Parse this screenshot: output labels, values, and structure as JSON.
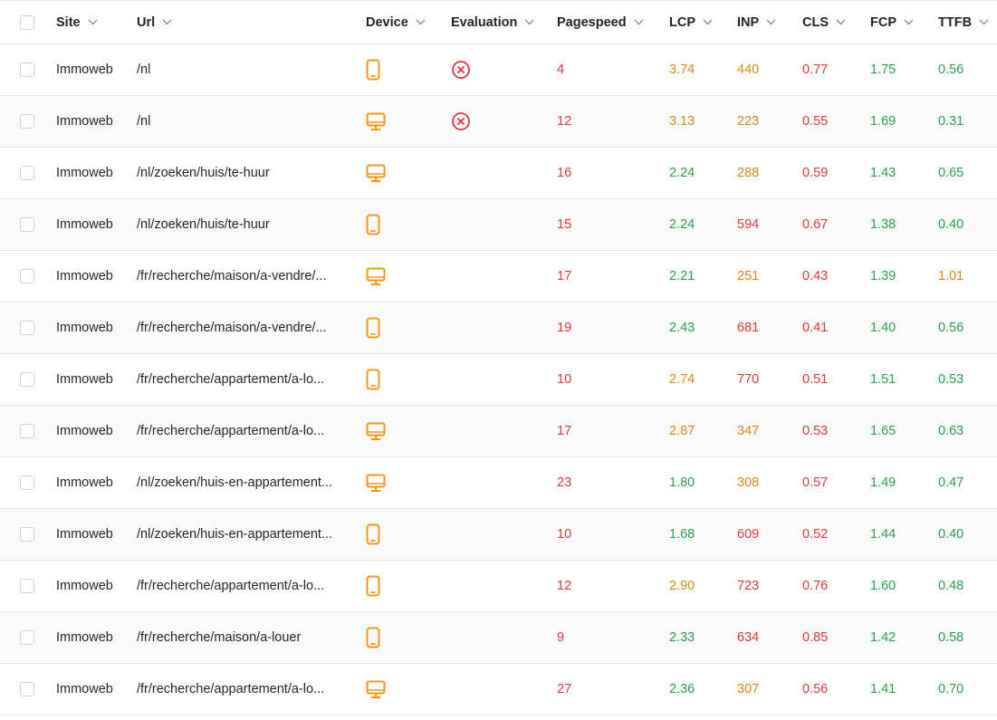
{
  "colors": {
    "good": "#2e9e4f",
    "warn": "#d9891a",
    "bad": "#e0383e",
    "device": "#f09a1a"
  },
  "header": {
    "site": "Site",
    "url": "Url",
    "device": "Device",
    "evaluation": "Evaluation",
    "pagespeed": "Pagespeed",
    "lcp": "LCP",
    "inp": "INP",
    "cls": "CLS",
    "fcp": "FCP",
    "ttfb": "TTFB"
  },
  "rows": [
    {
      "site": "Immoweb",
      "url": "/nl",
      "device": "mobile",
      "evaluation": "failed",
      "pagespeed": {
        "v": "4",
        "s": "bad"
      },
      "lcp": {
        "v": "3.74",
        "s": "warn"
      },
      "inp": {
        "v": "440",
        "s": "warn"
      },
      "cls": {
        "v": "0.77",
        "s": "bad"
      },
      "fcp": {
        "v": "1.75",
        "s": "good"
      },
      "ttfb": {
        "v": "0.56",
        "s": "good"
      }
    },
    {
      "site": "Immoweb",
      "url": "/nl",
      "device": "desktop",
      "evaluation": "failed",
      "pagespeed": {
        "v": "12",
        "s": "bad"
      },
      "lcp": {
        "v": "3.13",
        "s": "warn"
      },
      "inp": {
        "v": "223",
        "s": "warn"
      },
      "cls": {
        "v": "0.55",
        "s": "bad"
      },
      "fcp": {
        "v": "1.69",
        "s": "good"
      },
      "ttfb": {
        "v": "0.31",
        "s": "good"
      }
    },
    {
      "site": "Immoweb",
      "url": "/nl/zoeken/huis/te-huur",
      "device": "desktop",
      "evaluation": "",
      "pagespeed": {
        "v": "16",
        "s": "bad"
      },
      "lcp": {
        "v": "2.24",
        "s": "good"
      },
      "inp": {
        "v": "288",
        "s": "warn"
      },
      "cls": {
        "v": "0.59",
        "s": "bad"
      },
      "fcp": {
        "v": "1.43",
        "s": "good"
      },
      "ttfb": {
        "v": "0.65",
        "s": "good"
      }
    },
    {
      "site": "Immoweb",
      "url": "/nl/zoeken/huis/te-huur",
      "device": "mobile",
      "evaluation": "",
      "pagespeed": {
        "v": "15",
        "s": "bad"
      },
      "lcp": {
        "v": "2.24",
        "s": "good"
      },
      "inp": {
        "v": "594",
        "s": "bad"
      },
      "cls": {
        "v": "0.67",
        "s": "bad"
      },
      "fcp": {
        "v": "1.38",
        "s": "good"
      },
      "ttfb": {
        "v": "0.40",
        "s": "good"
      }
    },
    {
      "site": "Immoweb",
      "url": "/fr/recherche/maison/a-vendre/...",
      "device": "desktop",
      "evaluation": "",
      "pagespeed": {
        "v": "17",
        "s": "bad"
      },
      "lcp": {
        "v": "2.21",
        "s": "good"
      },
      "inp": {
        "v": "251",
        "s": "warn"
      },
      "cls": {
        "v": "0.43",
        "s": "bad"
      },
      "fcp": {
        "v": "1.39",
        "s": "good"
      },
      "ttfb": {
        "v": "1.01",
        "s": "warn"
      }
    },
    {
      "site": "Immoweb",
      "url": "/fr/recherche/maison/a-vendre/...",
      "device": "mobile",
      "evaluation": "",
      "pagespeed": {
        "v": "19",
        "s": "bad"
      },
      "lcp": {
        "v": "2.43",
        "s": "good"
      },
      "inp": {
        "v": "681",
        "s": "bad"
      },
      "cls": {
        "v": "0.41",
        "s": "bad"
      },
      "fcp": {
        "v": "1.40",
        "s": "good"
      },
      "ttfb": {
        "v": "0.56",
        "s": "good"
      }
    },
    {
      "site": "Immoweb",
      "url": "/fr/recherche/appartement/a-lo...",
      "device": "mobile",
      "evaluation": "",
      "pagespeed": {
        "v": "10",
        "s": "bad"
      },
      "lcp": {
        "v": "2.74",
        "s": "warn"
      },
      "inp": {
        "v": "770",
        "s": "bad"
      },
      "cls": {
        "v": "0.51",
        "s": "bad"
      },
      "fcp": {
        "v": "1.51",
        "s": "good"
      },
      "ttfb": {
        "v": "0.53",
        "s": "good"
      }
    },
    {
      "site": "Immoweb",
      "url": "/fr/recherche/appartement/a-lo...",
      "device": "desktop",
      "evaluation": "",
      "pagespeed": {
        "v": "17",
        "s": "bad"
      },
      "lcp": {
        "v": "2.87",
        "s": "warn"
      },
      "inp": {
        "v": "347",
        "s": "warn"
      },
      "cls": {
        "v": "0.53",
        "s": "bad"
      },
      "fcp": {
        "v": "1.65",
        "s": "good"
      },
      "ttfb": {
        "v": "0.63",
        "s": "good"
      }
    },
    {
      "site": "Immoweb",
      "url": "/nl/zoeken/huis-en-appartement...",
      "device": "desktop",
      "evaluation": "",
      "pagespeed": {
        "v": "23",
        "s": "bad"
      },
      "lcp": {
        "v": "1.80",
        "s": "good"
      },
      "inp": {
        "v": "308",
        "s": "warn"
      },
      "cls": {
        "v": "0.57",
        "s": "bad"
      },
      "fcp": {
        "v": "1.49",
        "s": "good"
      },
      "ttfb": {
        "v": "0.47",
        "s": "good"
      }
    },
    {
      "site": "Immoweb",
      "url": "/nl/zoeken/huis-en-appartement...",
      "device": "mobile",
      "evaluation": "",
      "pagespeed": {
        "v": "10",
        "s": "bad"
      },
      "lcp": {
        "v": "1.68",
        "s": "good"
      },
      "inp": {
        "v": "609",
        "s": "bad"
      },
      "cls": {
        "v": "0.52",
        "s": "bad"
      },
      "fcp": {
        "v": "1.44",
        "s": "good"
      },
      "ttfb": {
        "v": "0.40",
        "s": "good"
      }
    },
    {
      "site": "Immoweb",
      "url": "/fr/recherche/appartement/a-lo...",
      "device": "mobile",
      "evaluation": "",
      "pagespeed": {
        "v": "12",
        "s": "bad"
      },
      "lcp": {
        "v": "2.90",
        "s": "warn"
      },
      "inp": {
        "v": "723",
        "s": "bad"
      },
      "cls": {
        "v": "0.76",
        "s": "bad"
      },
      "fcp": {
        "v": "1.60",
        "s": "good"
      },
      "ttfb": {
        "v": "0.48",
        "s": "good"
      }
    },
    {
      "site": "Immoweb",
      "url": "/fr/recherche/maison/a-louer",
      "device": "mobile",
      "evaluation": "",
      "pagespeed": {
        "v": "9",
        "s": "bad"
      },
      "lcp": {
        "v": "2.33",
        "s": "good"
      },
      "inp": {
        "v": "634",
        "s": "bad"
      },
      "cls": {
        "v": "0.85",
        "s": "bad"
      },
      "fcp": {
        "v": "1.42",
        "s": "good"
      },
      "ttfb": {
        "v": "0.58",
        "s": "good"
      }
    },
    {
      "site": "Immoweb",
      "url": "/fr/recherche/appartement/a-lo...",
      "device": "desktop",
      "evaluation": "",
      "pagespeed": {
        "v": "27",
        "s": "bad"
      },
      "lcp": {
        "v": "2.36",
        "s": "good"
      },
      "inp": {
        "v": "307",
        "s": "warn"
      },
      "cls": {
        "v": "0.56",
        "s": "bad"
      },
      "fcp": {
        "v": "1.41",
        "s": "good"
      },
      "ttfb": {
        "v": "0.70",
        "s": "good"
      }
    }
  ]
}
